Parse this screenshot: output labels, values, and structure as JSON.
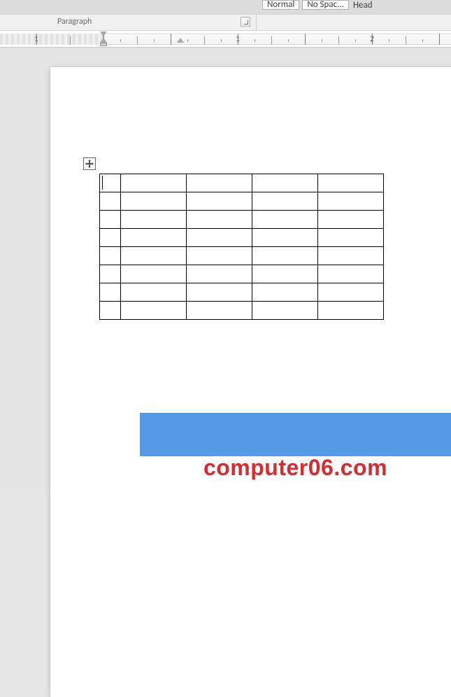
{
  "ribbon": {
    "group_label": "Paragraph",
    "styles": {
      "normal": "Normal",
      "no_spacing": "No Spac...",
      "heading": "Head"
    }
  },
  "ruler": {
    "visible_numbers": [
      "1",
      "1",
      "2"
    ]
  },
  "document": {
    "table": {
      "rows": 8,
      "cols": 5
    }
  },
  "watermark": {
    "text": "computer06.com"
  }
}
